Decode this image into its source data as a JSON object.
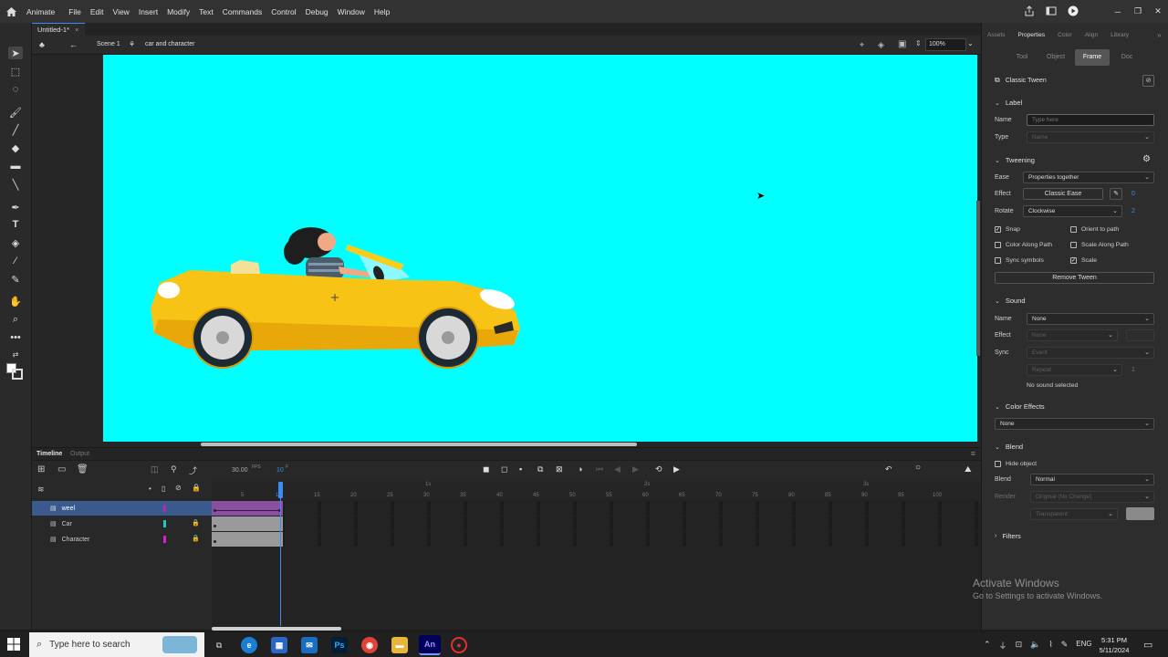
{
  "menubar": {
    "app": "Animate",
    "items": [
      "File",
      "Edit",
      "View",
      "Insert",
      "Modify",
      "Text",
      "Commands",
      "Control",
      "Debug",
      "Window",
      "Help"
    ]
  },
  "document": {
    "tab": "Untitled-1*"
  },
  "editbar": {
    "scene": "Scene 1",
    "symbol": "car and character",
    "zoom": "100%"
  },
  "timeline": {
    "tabs": [
      "Timeline",
      "Output"
    ],
    "fps": "30.00",
    "fps_unit": "FPS",
    "current_frame": "10",
    "frame_unit": "F",
    "ruler_ticks": [
      "5",
      "10",
      "15",
      "20",
      "25",
      "30",
      "35",
      "40",
      "45",
      "50",
      "55",
      "60",
      "65",
      "70",
      "75",
      "80",
      "85",
      "90",
      "95",
      "100"
    ],
    "seconds": [
      "1s",
      "2s",
      "3s"
    ],
    "layers": [
      {
        "name": "weel",
        "color": "#b02bb0",
        "selected": true
      },
      {
        "name": "Car",
        "color": "#1ec8c8",
        "selected": false
      },
      {
        "name": "Character",
        "color": "#d81ed8",
        "selected": false
      }
    ]
  },
  "props": {
    "tabs": [
      "Assets",
      "Properties",
      "Color",
      "Align",
      "Library"
    ],
    "active_tab": "Properties",
    "subtabs": [
      "Tool",
      "Object",
      "Frame",
      "Doc"
    ],
    "active_subtab": "Frame",
    "kind": "Classic Tween",
    "label_section": "Label",
    "name_label": "Name",
    "name_placeholder": "Type here",
    "type_label": "Type",
    "type_value": "Name",
    "tweening_section": "Tweening",
    "ease_label": "Ease",
    "ease_value": "Properties together",
    "effect_label": "Effect",
    "effect_value": "Classic Ease",
    "effect_num": "0",
    "rotate_label": "Rotate",
    "rotate_value": "Clockwise",
    "rotate_num": "2",
    "checks": [
      {
        "label": "Snap",
        "checked": true
      },
      {
        "label": "Orient to path",
        "checked": false
      },
      {
        "label": "Color Along Path",
        "checked": false
      },
      {
        "label": "Scale Along Path",
        "checked": false
      },
      {
        "label": "Sync symbols",
        "checked": false
      },
      {
        "label": "Scale",
        "checked": true
      }
    ],
    "remove_tween": "Remove Tween",
    "sound_section": "Sound",
    "sound_name_label": "Name",
    "sound_name_value": "None",
    "sound_effect_label": "Effect",
    "sound_effect_value": "None",
    "sync_label": "Sync",
    "sync_value": "Event",
    "repeat_value": "Repeat",
    "repeat_num": "1",
    "no_sound": "No sound selected",
    "color_effects_section": "Color Effects",
    "color_effects_value": "None",
    "blend_section": "Blend",
    "hide_object": "Hide object",
    "blend_label": "Blend",
    "blend_value": "Normal",
    "render_label": "Render",
    "render_value": "Original (No Change)",
    "transparent_value": "Transparent",
    "filters_section": "Filters"
  },
  "watermark": {
    "line1": "Activate Windows",
    "line2": "Go to Settings to activate Windows."
  },
  "taskbar": {
    "search_placeholder": "Type here to search",
    "time": "5:31 PM",
    "date": "5/11/2024",
    "lang": "ENG"
  },
  "colors": {
    "stage": "#00ffff",
    "car": "#f7c315",
    "accent": "#3b8df0"
  }
}
